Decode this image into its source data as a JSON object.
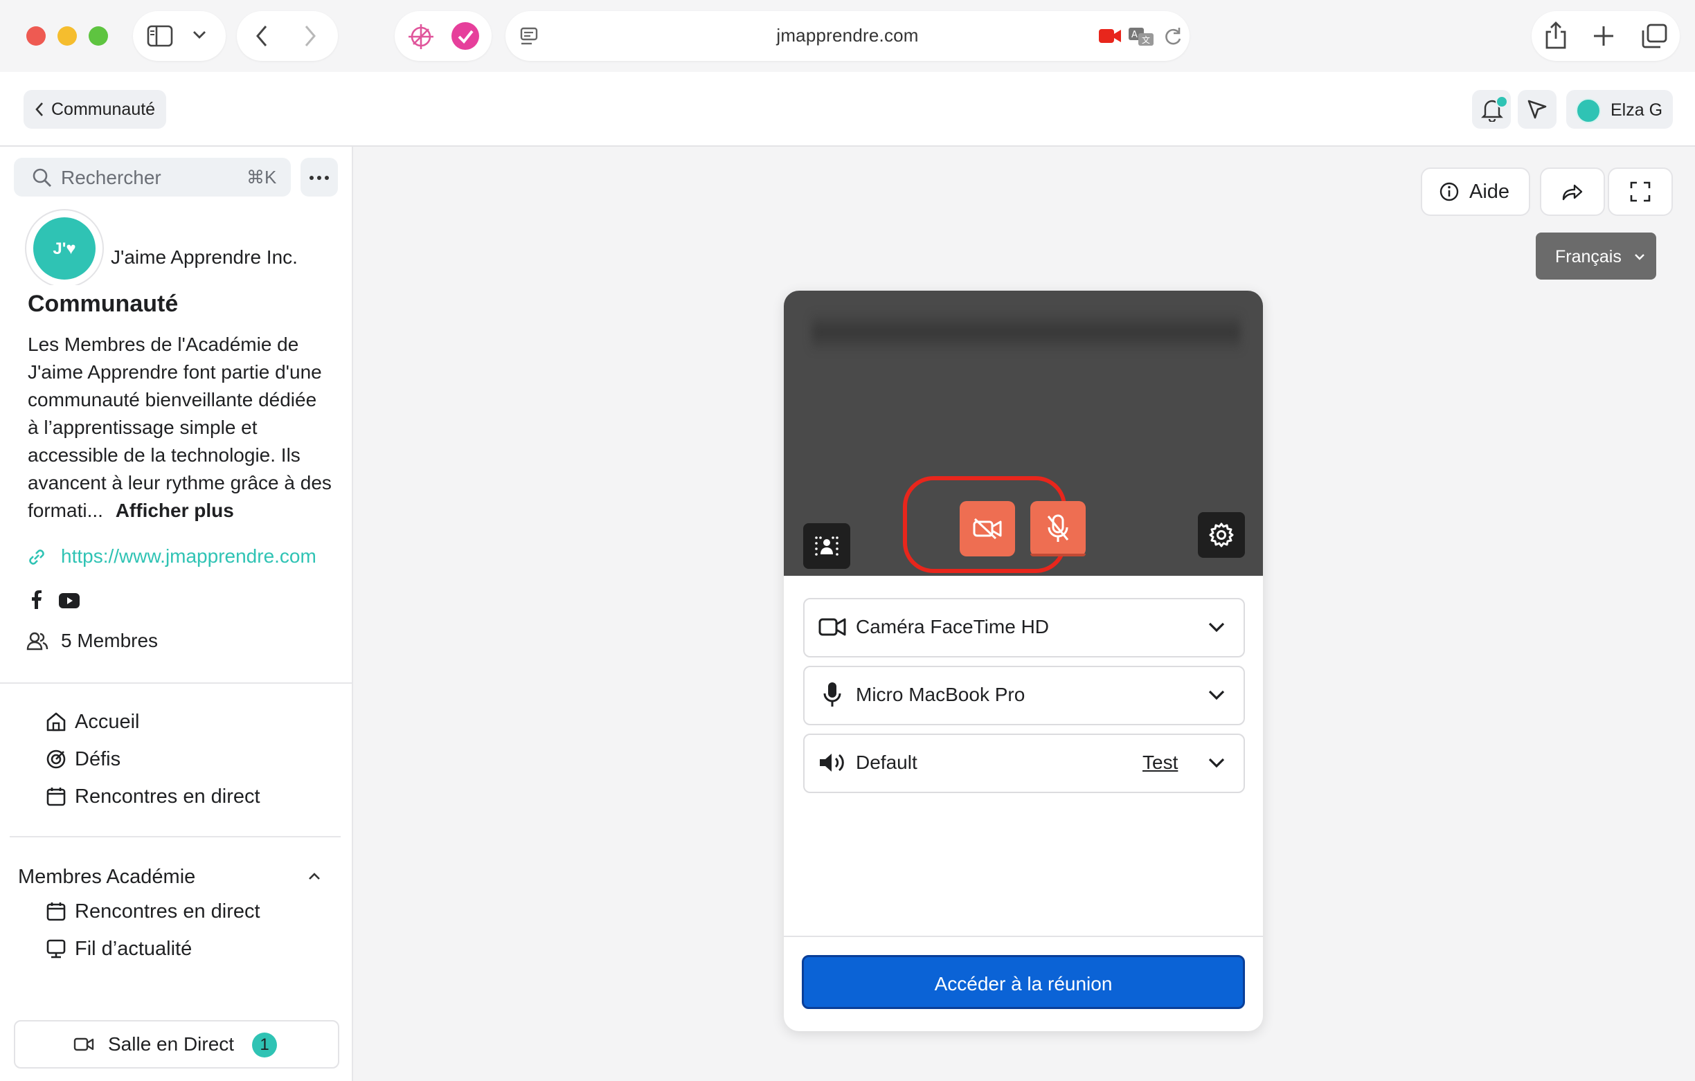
{
  "browser": {
    "url": "jmapprendre.com",
    "icons": [
      "sidebar-icon",
      "chevron-down-icon",
      "back-icon",
      "forward-icon",
      "tracker-icon",
      "check-icon",
      "page-icon",
      "camera-icon",
      "translate-icon",
      "reload-icon",
      "share-icon",
      "plus-icon",
      "tabs-icon"
    ]
  },
  "header": {
    "back_label": "Communauté",
    "user_name": "Elza G"
  },
  "sidebar": {
    "search_placeholder": "Rechercher",
    "search_shortcut": "⌘K",
    "logo_text": "J'♥",
    "org_name": "J'aime Apprendre Inc.",
    "title": "Communauté",
    "description": "Les Membres de l'Académie de J'aime Apprendre font partie d'une communauté bienveillante dédiée à l’apprentissage simple et accessible de la technologie. Ils avancent à leur rythme grâce à des formati...",
    "show_more": "Afficher plus",
    "link": "https://www.jmapprendre.com",
    "members": "5 Membres",
    "nav": [
      {
        "label": "Accueil",
        "icon": "home-icon"
      },
      {
        "label": "Défis",
        "icon": "target-icon"
      },
      {
        "label": "Rencontres en direct",
        "icon": "calendar-icon"
      }
    ],
    "section_title": "Membres Académie",
    "section_items": [
      {
        "label": "Rencontres en direct",
        "icon": "calendar-icon"
      },
      {
        "label": "Fil d’actualité",
        "icon": "monitor-icon"
      }
    ],
    "live_room": "Salle en Direct",
    "live_count": "1"
  },
  "main": {
    "help_label": "Aide",
    "language": "Français"
  },
  "card": {
    "camera": "Caméra FaceTime HD",
    "micro": "Micro MacBook Pro",
    "speaker": "Default",
    "test_label": "Test",
    "join_label": "Accéder à la réunion"
  },
  "colors": {
    "accent_teal": "#2fc3b4",
    "mute_orange": "#ee6e52",
    "highlight_red": "#e8261c",
    "primary_blue": "#0b63d6",
    "lang_button": "#6b6b6b"
  }
}
